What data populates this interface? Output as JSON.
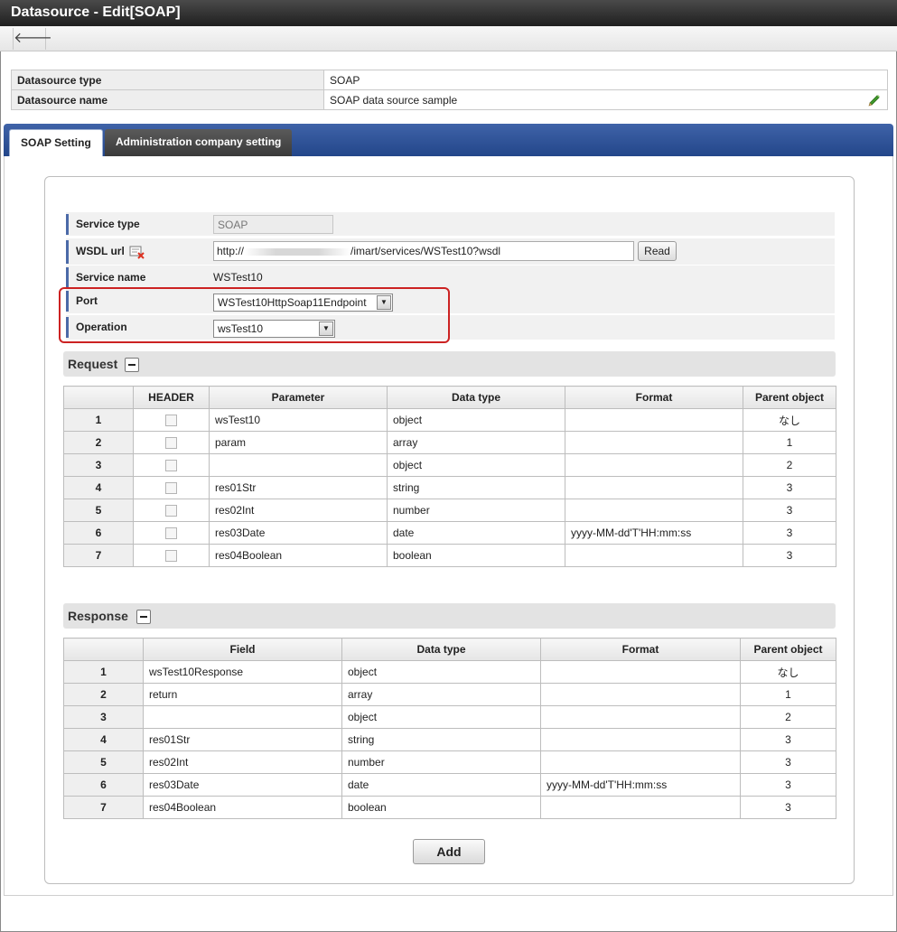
{
  "window": {
    "title": "Datasource - Edit[SOAP]"
  },
  "toolbar": {
    "back_icon": "left-arrow-icon"
  },
  "info": {
    "rows": [
      {
        "label": "Datasource type",
        "value": "SOAP"
      },
      {
        "label": "Datasource name",
        "value": "SOAP data source sample"
      }
    ]
  },
  "tabs": [
    {
      "label": "SOAP Setting",
      "active": true
    },
    {
      "label": "Administration company setting",
      "active": false
    }
  ],
  "form": {
    "service_type": {
      "label": "Service type",
      "value": "SOAP"
    },
    "wsdl_url": {
      "label": "WSDL url",
      "value_prefix": "http://",
      "value_suffix": "/imart/services/WSTest10?wsdl",
      "read_button": "Read"
    },
    "service_name": {
      "label": "Service name",
      "value": "WSTest10"
    },
    "port": {
      "label": "Port",
      "selected": "WSTest10HttpSoap11Endpoint"
    },
    "operation": {
      "label": "Operation",
      "selected": "wsTest10"
    }
  },
  "request": {
    "title": "Request",
    "columns": [
      "",
      "HEADER",
      "Parameter",
      "Data type",
      "Format",
      "Parent object"
    ],
    "rows": [
      {
        "no": "1",
        "param": "wsTest10",
        "type": "object",
        "format": "",
        "parent": "なし"
      },
      {
        "no": "2",
        "param": "param",
        "type": "array",
        "format": "",
        "parent": "1"
      },
      {
        "no": "3",
        "param": "",
        "type": "object",
        "format": "",
        "parent": "2"
      },
      {
        "no": "4",
        "param": "res01Str",
        "type": "string",
        "format": "",
        "parent": "3"
      },
      {
        "no": "5",
        "param": "res02Int",
        "type": "number",
        "format": "",
        "parent": "3"
      },
      {
        "no": "6",
        "param": "res03Date",
        "type": "date",
        "format": "yyyy-MM-dd'T'HH:mm:ss",
        "parent": "3"
      },
      {
        "no": "7",
        "param": "res04Boolean",
        "type": "boolean",
        "format": "",
        "parent": "3"
      }
    ]
  },
  "response": {
    "title": "Response",
    "columns": [
      "",
      "Field",
      "Data type",
      "Format",
      "Parent object"
    ],
    "rows": [
      {
        "no": "1",
        "field": "wsTest10Response",
        "type": "object",
        "format": "",
        "parent": "なし"
      },
      {
        "no": "2",
        "field": "return",
        "type": "array",
        "format": "",
        "parent": "1"
      },
      {
        "no": "3",
        "field": "",
        "type": "object",
        "format": "",
        "parent": "2"
      },
      {
        "no": "4",
        "field": "res01Str",
        "type": "string",
        "format": "",
        "parent": "3"
      },
      {
        "no": "5",
        "field": "res02Int",
        "type": "number",
        "format": "",
        "parent": "3"
      },
      {
        "no": "6",
        "field": "res03Date",
        "type": "date",
        "format": "yyyy-MM-dd'T'HH:mm:ss",
        "parent": "3"
      },
      {
        "no": "7",
        "field": "res04Boolean",
        "type": "boolean",
        "format": "",
        "parent": "3"
      }
    ]
  },
  "actions": {
    "add_label": "Add"
  },
  "colors": {
    "accent": "#2f5499",
    "highlight": "#cc2222"
  }
}
